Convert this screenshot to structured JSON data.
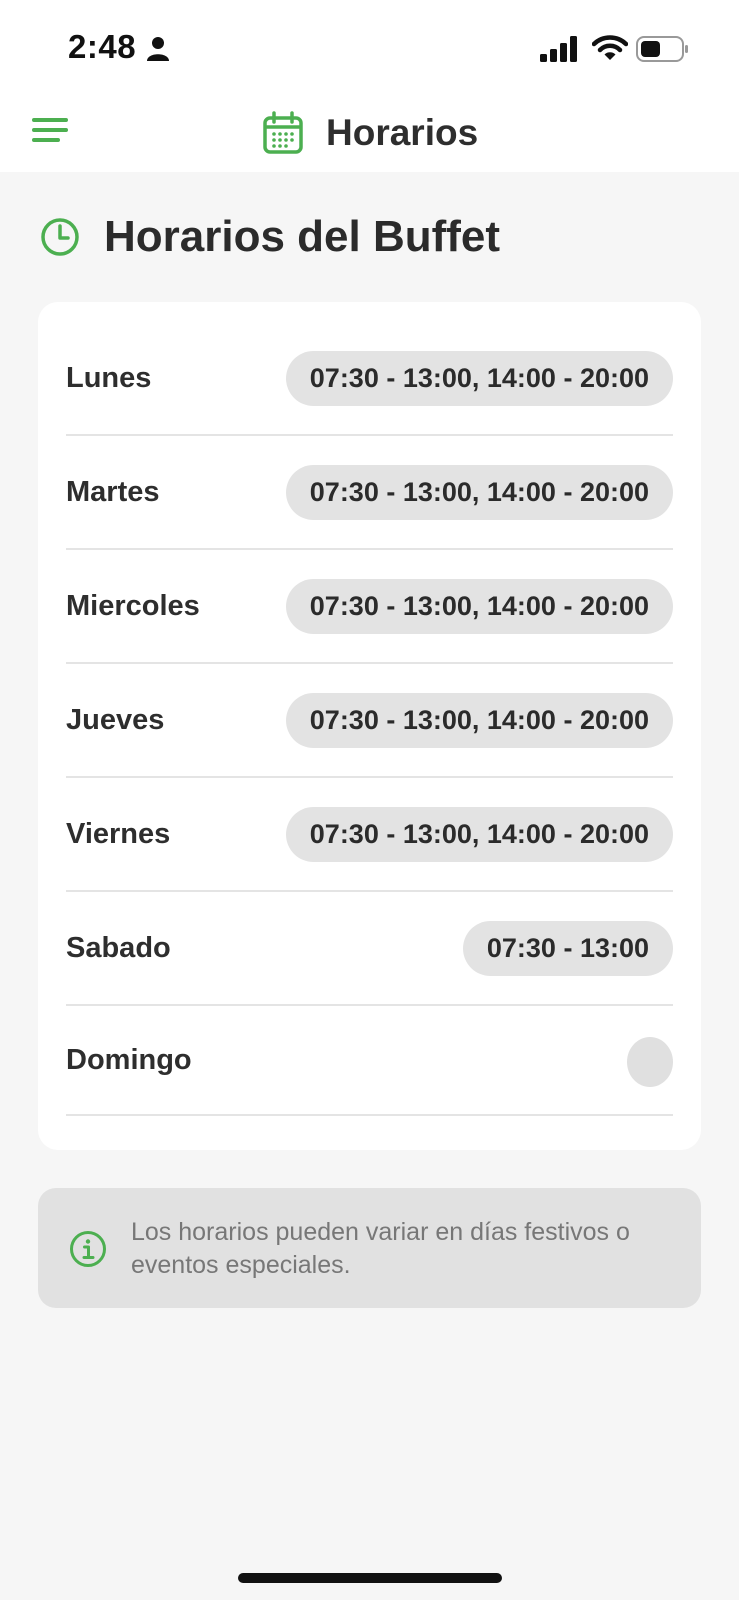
{
  "status_bar": {
    "time": "2:48",
    "icons": [
      "person-icon",
      "signal-icon",
      "wifi-icon",
      "battery-icon"
    ]
  },
  "header": {
    "menu_icon": "menu-icon",
    "title_icon": "calendar-icon",
    "title": "Horarios"
  },
  "section": {
    "icon": "clock-icon",
    "title": "Horarios del Buffet"
  },
  "schedule": [
    {
      "day": "Lunes",
      "hours": "07:30 - 13:00, 14:00 - 20:00"
    },
    {
      "day": "Martes",
      "hours": "07:30 - 13:00, 14:00 - 20:00"
    },
    {
      "day": "Miercoles",
      "hours": "07:30 - 13:00, 14:00 - 20:00"
    },
    {
      "day": "Jueves",
      "hours": "07:30 - 13:00, 14:00 - 20:00"
    },
    {
      "day": "Viernes",
      "hours": "07:30 - 13:00, 14:00 - 20:00"
    },
    {
      "day": "Sabado",
      "hours": "07:30 - 13:00"
    },
    {
      "day": "Domingo",
      "hours": ""
    }
  ],
  "notice": {
    "icon": "info-icon",
    "text": "Los horarios pueden variar en días festivos o eventos especiales."
  },
  "colors": {
    "accent": "#4caf50",
    "background": "#f6f6f6",
    "pill": "#e3e3e3",
    "notice_bg": "#e1e1e1"
  }
}
